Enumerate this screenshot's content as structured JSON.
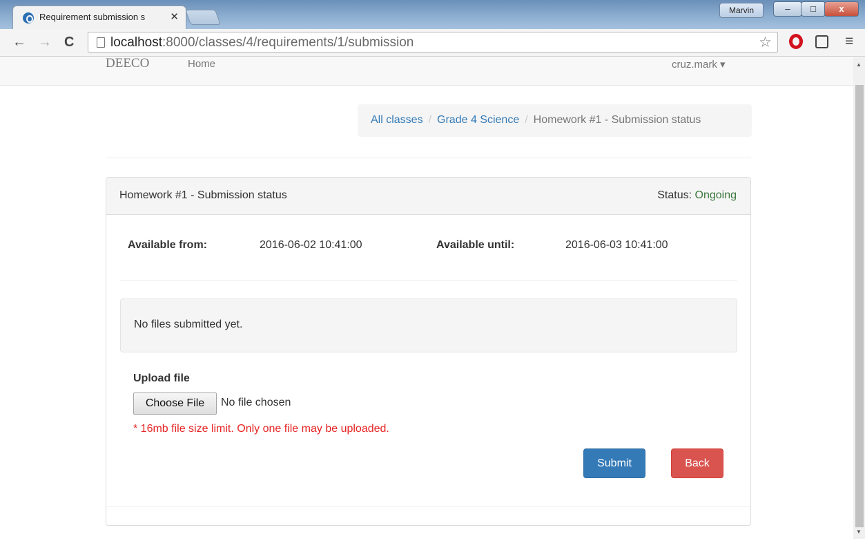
{
  "browser": {
    "tab_title": "Requirement submission s",
    "tab_close": "✕",
    "user_name": "Marvin",
    "url_host": "localhost",
    "url_path": ":8000/classes/4/requirements/1/submission",
    "win_min": "–",
    "win_max": "□",
    "win_close": "x"
  },
  "navbar": {
    "brand": "DEECO",
    "home": "Home",
    "user": "cruz.mark ▾"
  },
  "breadcrumb": {
    "items": [
      "All classes",
      "Grade 4 Science"
    ],
    "active": "Homework #1 - Submission status",
    "separator": "/"
  },
  "panel": {
    "title": "Homework #1 - Submission status",
    "status_label": "Status:",
    "status_value": "Ongoing",
    "available_from_label": "Available from:",
    "available_from": "2016-06-02 10:41:00",
    "available_until_label": "Available until:",
    "available_until": "2016-06-03 10:41:00",
    "no_files": "No files submitted yet.",
    "upload_label": "Upload file",
    "choose_file": "Choose File",
    "no_file_chosen": "No file chosen",
    "help": "* 16mb file size limit. Only one file may be uploaded.",
    "submit": "Submit",
    "back": "Back"
  },
  "icons": {
    "back": "←",
    "forward": "→",
    "reload": "C",
    "star": "☆",
    "menu": "≡"
  },
  "colors": {
    "primary": "#337ab7",
    "danger": "#d9534f",
    "success_text": "#3c763d",
    "help_text": "#e62222"
  }
}
